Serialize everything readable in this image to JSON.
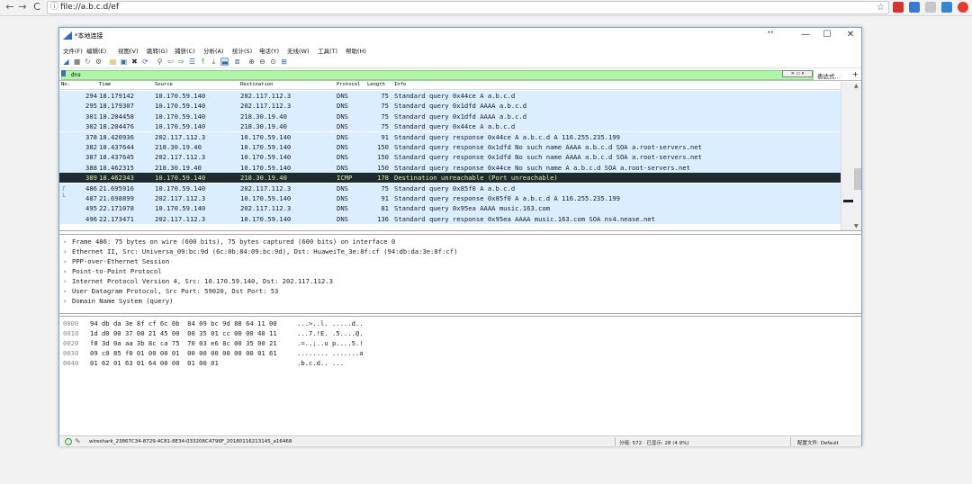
{
  "browser": {
    "url": "file://a.b.c.d/ef",
    "back": "←",
    "forward": "→",
    "reload": "C",
    "info": "ⓘ",
    "star": "☆"
  },
  "window": {
    "title": "*本地连接",
    "pin": "••",
    "minimize": "—",
    "maximize": "☐",
    "close": "✕"
  },
  "menu": [
    "文件(F)",
    "编辑(E)",
    "视图(V)",
    "跳转(G)",
    "捕获(C)",
    "分析(A)",
    "统计(S)",
    "电话(Y)",
    "无线(W)",
    "工具(T)",
    "帮助(H)"
  ],
  "filter": {
    "value": "dns",
    "expression": "表达式…",
    "plus": "+"
  },
  "packet_list": {
    "headers": {
      "no": "No.",
      "time": "Time",
      "source": "Source",
      "destination": "Destination",
      "protocol": "Protocol",
      "length": "Length",
      "info": "Info"
    },
    "rows": [
      {
        "no": "294",
        "time": "18.179142",
        "src": "10.170.59.140",
        "dst": "202.117.112.3",
        "proto": "DNS",
        "len": "75",
        "info": "Standard query 0x44ce A a.b.c.d"
      },
      {
        "no": "295",
        "time": "18.179307",
        "src": "10.170.59.140",
        "dst": "202.117.112.3",
        "proto": "DNS",
        "len": "75",
        "info": "Standard query 0x1dfd AAAA a.b.c.d"
      },
      {
        "no": "301",
        "time": "18.204458",
        "src": "10.170.59.140",
        "dst": "218.30.19.40",
        "proto": "DNS",
        "len": "75",
        "info": "Standard query 0x1dfd AAAA a.b.c.d"
      },
      {
        "no": "302",
        "time": "18.204476",
        "src": "10.170.59.140",
        "dst": "218.30.19.40",
        "proto": "DNS",
        "len": "75",
        "info": "Standard query 0x44ce A a.b.c.d"
      },
      {
        "no": "378",
        "time": "18.420936",
        "src": "202.117.112.3",
        "dst": "10.170.59.140",
        "proto": "DNS",
        "len": "91",
        "info": "Standard query response 0x44ce A a.b.c.d A 116.255.235.199"
      },
      {
        "no": "382",
        "time": "18.437644",
        "src": "218.30.19.40",
        "dst": "10.170.59.140",
        "proto": "DNS",
        "len": "150",
        "info": "Standard query response 0x1dfd No such name AAAA a.b.c.d SOA a.root-servers.net"
      },
      {
        "no": "387",
        "time": "18.437645",
        "src": "202.117.112.3",
        "dst": "10.170.59.140",
        "proto": "DNS",
        "len": "150",
        "info": "Standard query response 0x1dfd No such name AAAA a.b.c.d SOA a.root-servers.net"
      },
      {
        "no": "388",
        "time": "18.462315",
        "src": "218.30.19.40",
        "dst": "10.170.59.140",
        "proto": "DNS",
        "len": "150",
        "info": "Standard query response 0x44ce No such name A a.b.c.d SOA a.root-servers.net"
      },
      {
        "no": "389",
        "time": "18.462343",
        "src": "10.170.59.140",
        "dst": "218.30.19.40",
        "proto": "ICMP",
        "len": "178",
        "info": "Destination unreachable (Port unreachable)"
      },
      {
        "no": "486",
        "time": "21.695916",
        "src": "10.170.59.140",
        "dst": "202.117.112.3",
        "proto": "DNS",
        "len": "75",
        "info": "Standard query 0x85f0 A a.b.c.d"
      },
      {
        "no": "487",
        "time": "21.698899",
        "src": "202.117.112.3",
        "dst": "10.170.59.140",
        "proto": "DNS",
        "len": "91",
        "info": "Standard query response 0x85f0 A a.b.c.d A 116.255.235.199"
      },
      {
        "no": "495",
        "time": "22.171078",
        "src": "10.170.59.140",
        "dst": "202.117.112.3",
        "proto": "DNS",
        "len": "81",
        "info": "Standard query 0x95ea AAAA music.163.com"
      },
      {
        "no": "496",
        "time": "22.173471",
        "src": "202.117.112.3",
        "dst": "10.170.59.140",
        "proto": "DNS",
        "len": "136",
        "info": "Standard query response 0x95ea AAAA music.163.com SOA ns4.nease.net"
      }
    ],
    "selected_index": 8,
    "row_color": "#dbeeff",
    "selected_color": "#1d2a30"
  },
  "details": [
    "Frame 486: 75 bytes on wire (600 bits), 75 bytes captured (600 bits) on interface 0",
    "Ethernet II, Src: Universa_09:bc:9d (6c:0b:84:09:bc:9d), Dst: HuaweiTe_3e:8f:cf (94:db:da:3e:8f:cf)",
    "PPP-over-Ethernet Session",
    "Point-to-Point Protocol",
    "Internet Protocol Version 4, Src: 10.170.59.140, Dst: 202.117.112.3",
    "User Datagram Protocol, Src Port: 59020, Dst Port: 53",
    "Domain Name System (query)"
  ],
  "bytes": [
    {
      "off": "0000",
      "hex": "94 db da 3e 8f cf 6c 0b  84 09 bc 9d 88 64 11 00",
      "ascii": "...>..l. .....d.."
    },
    {
      "off": "0010",
      "hex": "1d d0 00 37 00 21 45 00  00 35 01 cc 00 00 40 11",
      "ascii": "...7.!E. .5....@."
    },
    {
      "off": "0020",
      "hex": "f8 3d 0a aa 3b 8c ca 75  70 03 e6 8c 00 35 00 21",
      "ascii": ".=..;..u p....5.!"
    },
    {
      "off": "0030",
      "hex": "09 c0 85 f0 01 00 00 01  00 00 00 00 00 00 01 61",
      "ascii": "........ .......a"
    },
    {
      "off": "0040",
      "hex": "01 62 01 63 01 64 00 00  01 00 01",
      "ascii": ".b.c.d.. ..."
    }
  ],
  "status": {
    "file": "wireshark_23867C34-8729-4C81-8E34-033208C4796F_20180116213145_a16468",
    "counts": "分组: 572 · 已显示: 28 (4.9%)",
    "profile": "配置文件: Default"
  }
}
